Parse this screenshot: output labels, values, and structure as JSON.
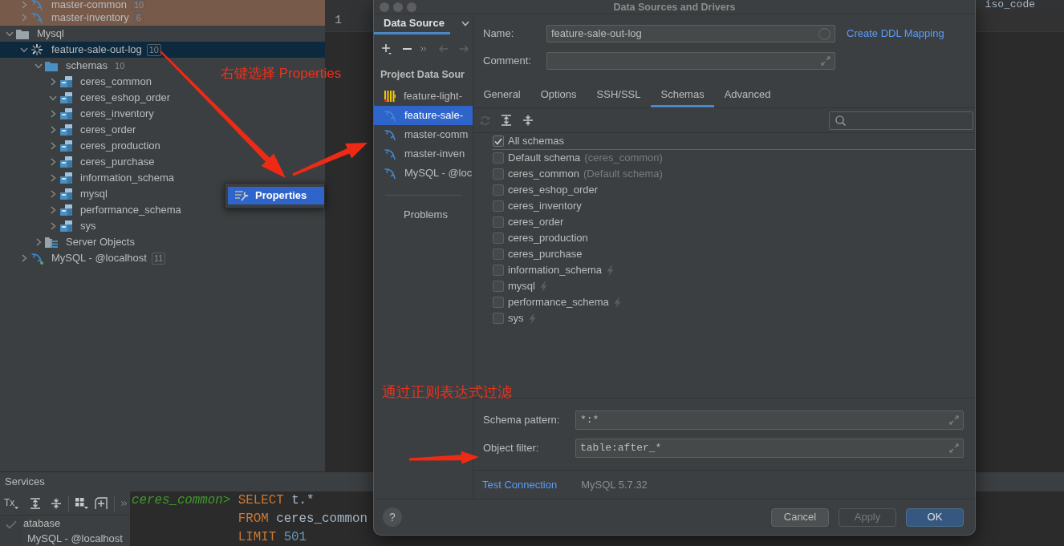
{
  "project_tree": {
    "items": [
      {
        "children": [
          {
            "label": "master-common",
            "kind": "datasource",
            "count": "10",
            "expanded": false,
            "selected": false,
            "loading": false,
            "connected": false,
            "color": "#785a4b"
          },
          {
            "label": "master-inventory",
            "kind": "datasource",
            "count": "6",
            "expanded": false,
            "selected": false,
            "loading": false,
            "connected": false,
            "color": "#785a4b"
          }
        ]
      },
      {
        "label": "Mysql",
        "kind": "group",
        "expanded": true,
        "selected": false,
        "children": [
          {
            "label": "feature-sale-out-log",
            "kind": "datasource",
            "count": "10",
            "expanded": true,
            "selected": true,
            "loading": true,
            "connected": false,
            "children": [
              {
                "label": "schemas",
                "kind": "folder",
                "count": "10",
                "expanded": true,
                "selected": false,
                "children": [
                  {
                    "label": "ceres_common",
                    "kind": "schema",
                    "expanded": false,
                    "selected": false
                  },
                  {
                    "label": "ceres_eshop_order",
                    "kind": "schema",
                    "expanded": true,
                    "selected": false
                  },
                  {
                    "label": "ceres_inventory",
                    "kind": "schema",
                    "expanded": false,
                    "selected": false
                  },
                  {
                    "label": "ceres_order",
                    "kind": "schema",
                    "expanded": false,
                    "selected": false
                  },
                  {
                    "label": "ceres_production",
                    "kind": "schema",
                    "expanded": false,
                    "selected": false
                  },
                  {
                    "label": "ceres_purchase",
                    "kind": "schema",
                    "expanded": false,
                    "selected": false
                  },
                  {
                    "label": "information_schema",
                    "kind": "schema",
                    "expanded": false,
                    "selected": false
                  },
                  {
                    "label": "mysql",
                    "kind": "schema",
                    "expanded": false,
                    "selected": false
                  },
                  {
                    "label": "performance_schema",
                    "kind": "schema",
                    "expanded": false,
                    "selected": false
                  },
                  {
                    "label": "sys",
                    "kind": "schema",
                    "expanded": false,
                    "selected": false
                  }
                ]
              },
              {
                "label": "Server Objects",
                "kind": "server_objects",
                "expanded": false,
                "selected": false
              }
            ]
          },
          {
            "label": "MySQL - @localhost",
            "kind": "datasource",
            "count": "11",
            "expanded": false,
            "selected": false,
            "loading": false,
            "connected": true
          }
        ]
      }
    ]
  },
  "editor": {
    "text_fragment": "iso_code",
    "line_numbers": [
      "1"
    ]
  },
  "context_menu": {
    "items": [
      {
        "label": "Properties",
        "selected": true
      }
    ]
  },
  "annotations": [
    {
      "text": "右键选择 Properties"
    },
    {
      "text": "通过正则表达式过滤"
    }
  ],
  "dialog": {
    "title": "Data Sources and Drivers",
    "sidebar": {
      "tab": "Data Source",
      "section": "Project Data Sour",
      "items": [
        {
          "label": "feature-light-",
          "kind": "bars",
          "selected": false
        },
        {
          "label": "feature-sale-",
          "kind": "dolphin",
          "selected": true
        },
        {
          "label": "master-comm",
          "kind": "dolphin",
          "selected": false
        },
        {
          "label": "master-inven",
          "kind": "dolphin",
          "selected": false
        },
        {
          "label": "MySQL - @loc",
          "kind": "dolphin",
          "selected": false
        }
      ],
      "problems": "Problems"
    },
    "name": {
      "label": "Name:",
      "value": "feature-sale-out-log"
    },
    "comment": {
      "label": "Comment:"
    },
    "ddl_link": "Create DDL Mapping",
    "tabs": [
      {
        "label": "General",
        "selected": false
      },
      {
        "label": "Options",
        "selected": false
      },
      {
        "label": "SSH/SSL",
        "selected": false
      },
      {
        "label": "Schemas",
        "selected": true
      },
      {
        "label": "Advanced",
        "selected": false
      }
    ],
    "all_schemas": {
      "label": "All schemas",
      "checked": true
    },
    "schemas": [
      {
        "label": "Default schema",
        "note": "(ceres_common)",
        "checked": false,
        "system": false
      },
      {
        "label": "ceres_common",
        "note": "(Default schema)",
        "checked": false,
        "system": false
      },
      {
        "label": "ceres_eshop_order",
        "checked": false,
        "system": false
      },
      {
        "label": "ceres_inventory",
        "checked": false,
        "system": false
      },
      {
        "label": "ceres_order",
        "checked": false,
        "system": false
      },
      {
        "label": "ceres_production",
        "checked": false,
        "system": false
      },
      {
        "label": "ceres_purchase",
        "checked": false,
        "system": false
      },
      {
        "label": "information_schema",
        "checked": false,
        "system": true
      },
      {
        "label": "mysql",
        "checked": false,
        "system": true
      },
      {
        "label": "performance_schema",
        "checked": false,
        "system": true
      },
      {
        "label": "sys",
        "checked": false,
        "system": true
      }
    ],
    "schema_pattern": {
      "label": "Schema pattern:",
      "value": "*:*"
    },
    "object_filter": {
      "label": "Object filter:",
      "value": "table:after_*"
    },
    "test_connection": "Test Connection",
    "server_version": "MySQL 5.7.32",
    "help": "?",
    "buttons": [
      {
        "label": "Cancel",
        "kind": "default",
        "disabled": false
      },
      {
        "label": "Apply",
        "kind": "default",
        "disabled": true
      },
      {
        "label": "OK",
        "kind": "primary",
        "disabled": false
      }
    ]
  },
  "services": {
    "title": "Services",
    "tx_label": "Tx",
    "tree": [
      {
        "label": "atabase"
      },
      {
        "label": "MySQL - @localhost"
      }
    ],
    "console": {
      "prompt": "ceres_common>",
      "lines": [
        [
          {
            "kind": "keyword",
            "text": "SELECT"
          },
          {
            "kind": "plain",
            "text": "t.*"
          }
        ],
        [
          {
            "kind": "keyword",
            "text": "FROM"
          },
          {
            "kind": "plain",
            "text": "ceres_common"
          }
        ],
        [
          {
            "kind": "keyword",
            "text": "LIMIT"
          },
          {
            "kind": "number",
            "text": "501"
          }
        ]
      ]
    }
  }
}
